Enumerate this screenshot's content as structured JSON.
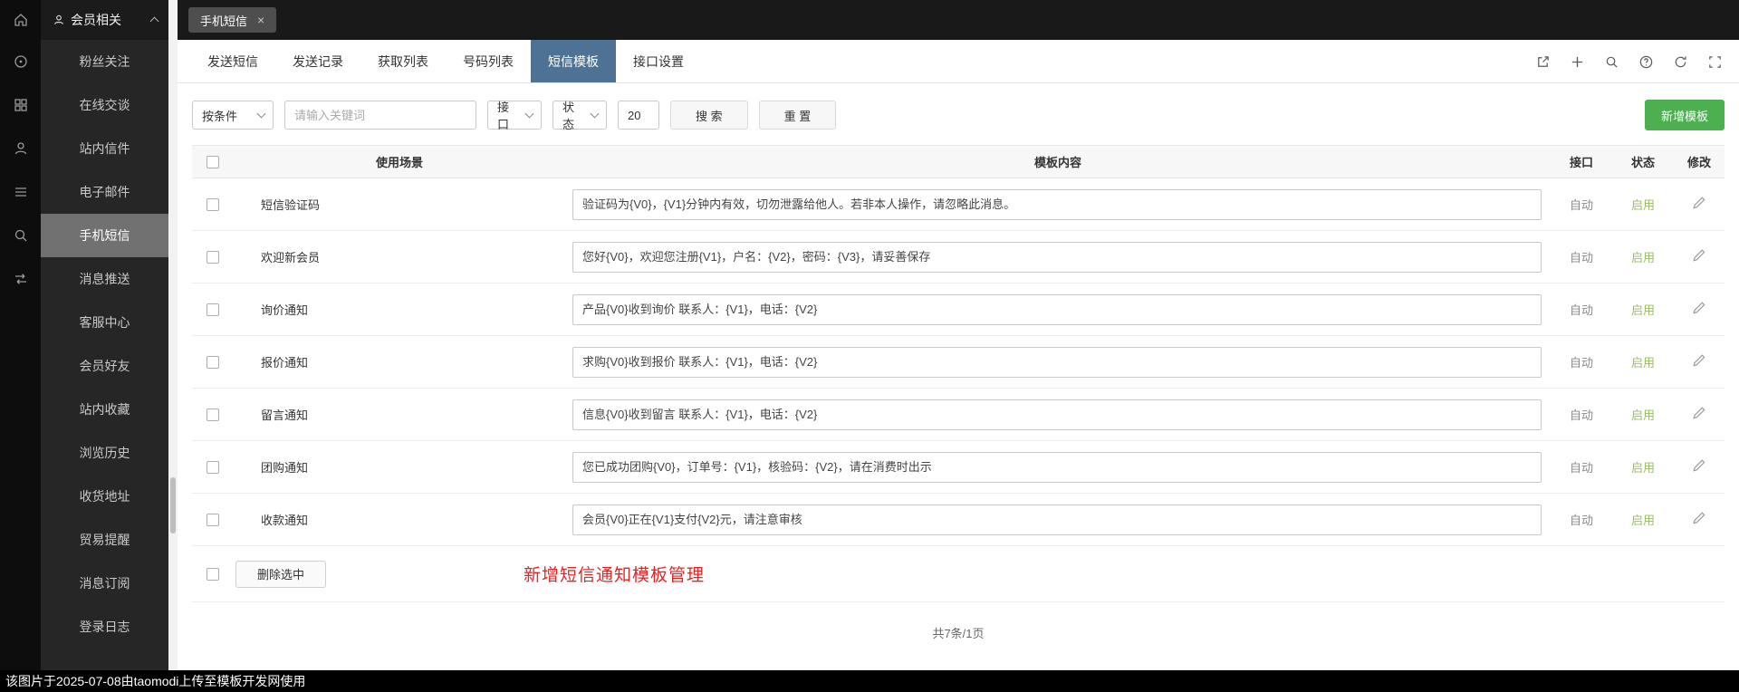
{
  "meta": {
    "bottom_bar_text": "该图片于2025-07-08由taomodi上传至模板开发网使用"
  },
  "colors": {
    "active_tab_blue": "#4e7293",
    "primary_green": "#4caf50",
    "status_enabled_green": "#95c15e",
    "note_red": "#e02626",
    "rail_bg": "#0d0d0d",
    "sidebar_bg": "#262626",
    "topbar_bg": "#191919"
  },
  "icon_rail": {
    "icons": [
      "home-icon",
      "target-icon",
      "grid-icon",
      "user-icon",
      "menu-icon",
      "search-icon",
      "swap-icon"
    ]
  },
  "sidebar": {
    "header": {
      "label": "会员相关"
    },
    "items": [
      {
        "label": "粉丝关注"
      },
      {
        "label": "在线交谈"
      },
      {
        "label": "站内信件"
      },
      {
        "label": "电子邮件"
      },
      {
        "label": "手机短信",
        "active": true
      },
      {
        "label": "消息推送"
      },
      {
        "label": "客服中心"
      },
      {
        "label": "会员好友"
      },
      {
        "label": "站内收藏"
      },
      {
        "label": "浏览历史"
      },
      {
        "label": "收货地址"
      },
      {
        "label": "贸易提醒"
      },
      {
        "label": "消息订阅"
      },
      {
        "label": "登录日志"
      }
    ]
  },
  "window_tabs": [
    {
      "label": "手机短信",
      "close": "×"
    }
  ],
  "nav_tabs": [
    {
      "label": "发送短信"
    },
    {
      "label": "发送记录"
    },
    {
      "label": "获取列表"
    },
    {
      "label": "号码列表"
    },
    {
      "label": "短信模板",
      "active": true
    },
    {
      "label": "接口设置"
    }
  ],
  "toolbar": {
    "icons": [
      "export-icon",
      "plus-icon",
      "search-icon",
      "help-icon",
      "refresh-icon",
      "fullscreen-icon"
    ]
  },
  "filters": {
    "condition_select": "按条件",
    "keyword_placeholder": "请输入关键词",
    "interface_select": "接口",
    "status_select": "状态",
    "page_size": "20",
    "search_label": "搜 索",
    "reset_label": "重 置",
    "add_button": "新增模板"
  },
  "table": {
    "headers": {
      "scene": "使用场景",
      "content": "模板内容",
      "interface": "接口",
      "status": "状态",
      "edit": "修改"
    },
    "rows": [
      {
        "scene": "短信验证码",
        "content": "验证码为{V0}，{V1}分钟内有效，切勿泄露给他人。若非本人操作，请忽略此消息。",
        "interface": "自动",
        "status": "启用"
      },
      {
        "scene": "欢迎新会员",
        "content": "您好{V0}，欢迎您注册{V1}，户名：{V2}，密码：{V3}，请妥善保存",
        "interface": "自动",
        "status": "启用"
      },
      {
        "scene": "询价通知",
        "content": "产品{V0}收到询价 联系人：{V1}，电话：{V2}",
        "interface": "自动",
        "status": "启用"
      },
      {
        "scene": "报价通知",
        "content": "求购{V0}收到报价 联系人：{V1}，电话：{V2}",
        "interface": "自动",
        "status": "启用"
      },
      {
        "scene": "留言通知",
        "content": "信息{V0}收到留言 联系人：{V1}，电话：{V2}",
        "interface": "自动",
        "status": "启用"
      },
      {
        "scene": "团购通知",
        "content": "您已成功团购{V0}，订单号：{V1}，核验码：{V2}，请在消费时出示",
        "interface": "自动",
        "status": "启用"
      },
      {
        "scene": "收款通知",
        "content": "会员{V0}正在{V1}支付{V2}元，请注意审核",
        "interface": "自动",
        "status": "启用"
      }
    ],
    "footer": {
      "delete_button": "删除选中",
      "note": "新增短信通知模板管理"
    }
  },
  "pagination": {
    "summary": "共7条/1页"
  }
}
